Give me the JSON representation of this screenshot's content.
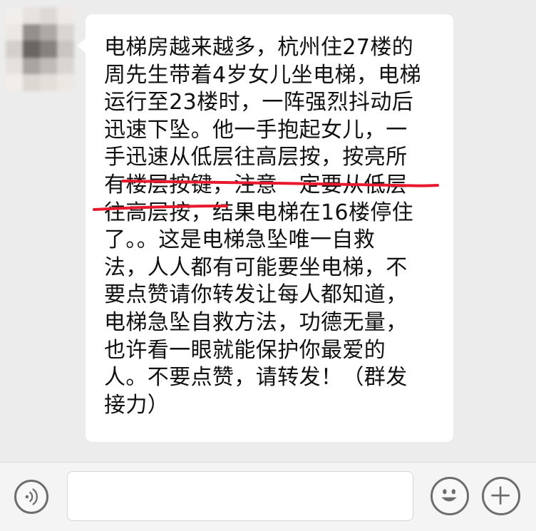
{
  "chat": {
    "message": {
      "lines": [
        "电梯房越来越多，杭州住27楼的",
        "周先生带着4岁女儿坐电梯，电梯",
        "运行至23楼时，一阵强烈抖动后",
        "迅速下坠。他一手抱起女儿，一",
        "手迅速从低层往高层按，按亮所",
        "有楼层按键，注意一定要从低层",
        "往高层按，结果电梯在16楼停住",
        "了。。这是电梯急坠唯一自救",
        "法，人人都有可能要坐电梯，不",
        "要点赞请你转发让每人都知道，",
        "电梯急坠自救方法，功德无量，",
        "也许看一眼就能保护你最爱的",
        "人。不要点赞，请转发！（群发",
        "接力）"
      ]
    }
  },
  "input_bar": {
    "text_value": "",
    "voice_icon": "voice-icon",
    "emoji_icon": "smiley-icon",
    "plus_icon": "plus-icon"
  },
  "colors": {
    "background": "#ececec",
    "bubble": "#ffffff",
    "text": "#111111",
    "underline": "#e8192c",
    "icon": "#6d6d6d"
  }
}
